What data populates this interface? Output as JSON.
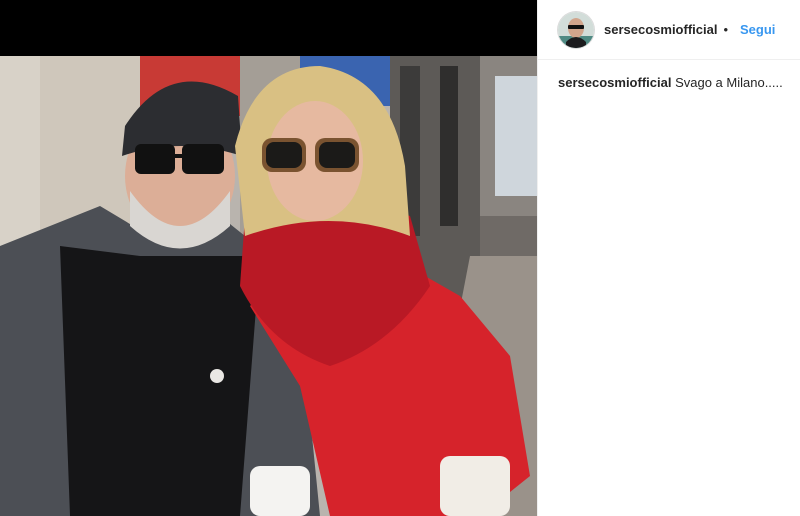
{
  "post": {
    "username": "sersecosmiofficial",
    "separator": "•",
    "follow_label": "Segui",
    "caption_user": "sersecosmiofficial",
    "caption_text": "Svago a Milano....."
  },
  "photo": {
    "description_icon": "photo-two-people-street"
  },
  "colors": {
    "follow_blue": "#3897f0",
    "text_dark": "#262626",
    "divider": "#efefef"
  }
}
